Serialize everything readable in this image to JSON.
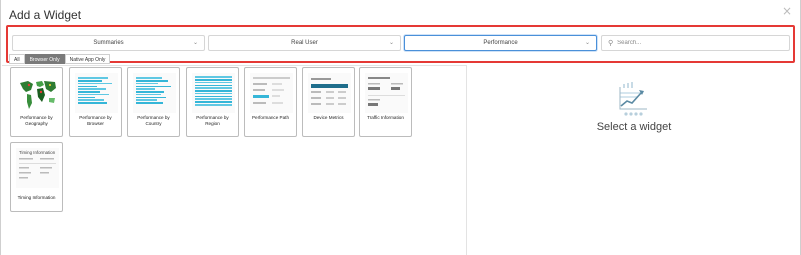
{
  "dialog": {
    "title": "Add a Widget",
    "close_glyph": "×"
  },
  "filters": {
    "category": "Summaries",
    "source": "Real User",
    "type": "Performance",
    "search_placeholder": "Search..."
  },
  "tabs": [
    {
      "label": "All",
      "active": false
    },
    {
      "label": "Browser Only",
      "active": true
    },
    {
      "label": "Native App Only",
      "active": false
    }
  ],
  "widgets": [
    {
      "label": "Performance by Geography",
      "thumb": "map-icon"
    },
    {
      "label": "Performance by Browser",
      "thumb": "bar-list"
    },
    {
      "label": "Performance by Country",
      "thumb": "bar-list"
    },
    {
      "label": "Performance by Region",
      "thumb": "bar-list"
    },
    {
      "label": "Performance Path",
      "thumb": "path-table"
    },
    {
      "label": "Device Metrics",
      "thumb": "table"
    },
    {
      "label": "Traffic Information",
      "thumb": "info-table"
    },
    {
      "label": "Timing Information",
      "thumb": "timing-table",
      "thumb_title": "Timing Information"
    }
  ],
  "preview": {
    "empty_text": "Select a widget",
    "icon": "chart-growth-icon"
  },
  "colors": {
    "highlight": "#e53935",
    "accent": "#35b6d8",
    "tab_active": "#7a7a7a",
    "focus": "#4a90d9"
  }
}
